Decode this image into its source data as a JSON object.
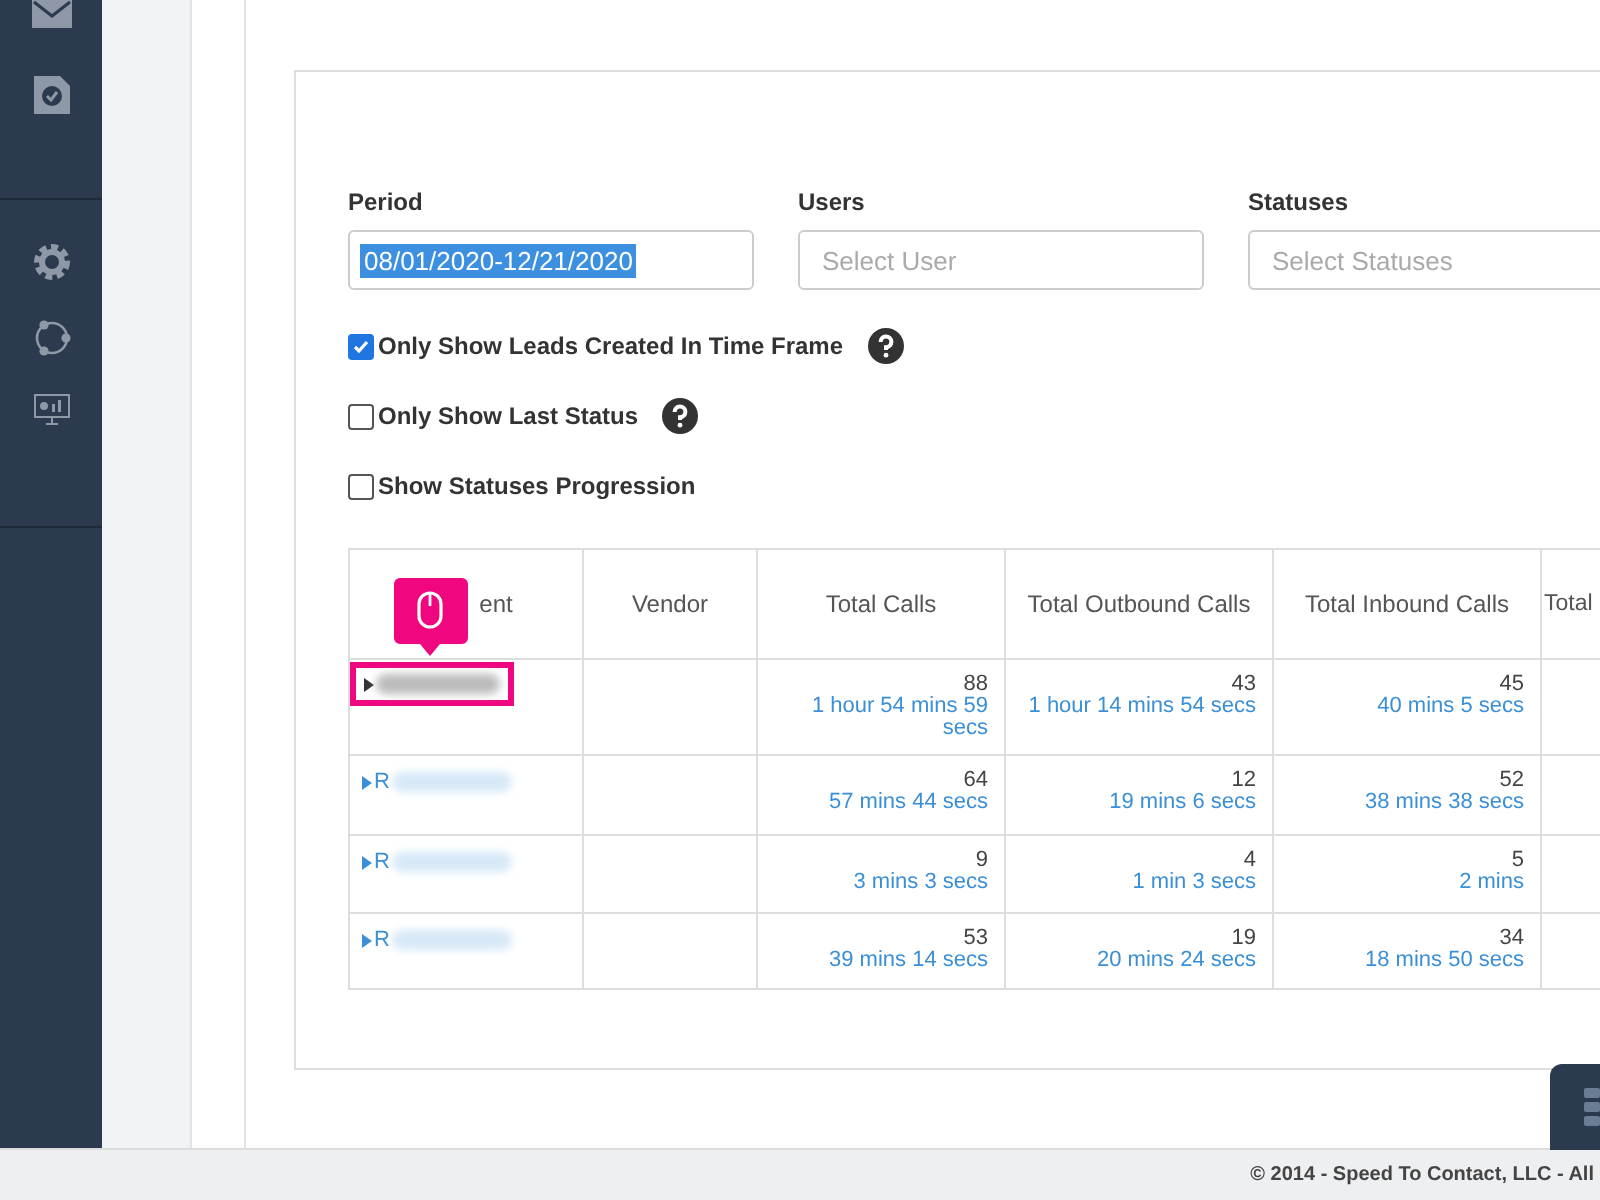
{
  "filters": [
    {
      "label": "Period",
      "value": "08/01/2020-12/21/2020",
      "selected_text": true
    },
    {
      "label": "Users",
      "placeholder": "Select User"
    },
    {
      "label": "Statuses",
      "placeholder": "Select Statuses"
    }
  ],
  "options": [
    {
      "label": "Only Show Leads Created In Time Frame",
      "checked": true,
      "help": true
    },
    {
      "label": "Only Show Last Status",
      "checked": false,
      "help": true
    },
    {
      "label": "Show Statuses Progression",
      "checked": false,
      "help": false
    }
  ],
  "table": {
    "columns": [
      "ent",
      "Vendor",
      "Total Calls",
      "Total Outbound Calls",
      "Total Inbound Calls",
      "Total"
    ],
    "rows": [
      {
        "highlighted": true,
        "expanded": false,
        "total_calls": "88",
        "total_time": "1 hour 54 mins 59 secs",
        "outbound_calls": "43",
        "outbound_time": "1 hour 14 mins 54 secs",
        "inbound_calls": "45",
        "inbound_time": "40 mins 5 secs"
      },
      {
        "highlighted": false,
        "expanded": false,
        "name": "R",
        "total_calls": "64",
        "total_time": "57 mins 44 secs",
        "outbound_calls": "12",
        "outbound_time": "19 mins 6 secs",
        "inbound_calls": "52",
        "inbound_time": "38 mins 38 secs"
      },
      {
        "highlighted": false,
        "expanded": false,
        "name": "R",
        "total_calls": "9",
        "total_time": "3 mins 3 secs",
        "outbound_calls": "4",
        "outbound_time": "1 min 3 secs",
        "inbound_calls": "5",
        "inbound_time": "2 mins"
      },
      {
        "highlighted": false,
        "expanded": false,
        "name": "R",
        "total_calls": "53",
        "total_time": "39 mins 14 secs",
        "outbound_calls": "19",
        "outbound_time": "20 mins 24 secs",
        "inbound_calls": "34",
        "inbound_time": "18 mins 50 secs"
      }
    ]
  },
  "footer": "© 2014 - Speed To Contact, LLC - All"
}
